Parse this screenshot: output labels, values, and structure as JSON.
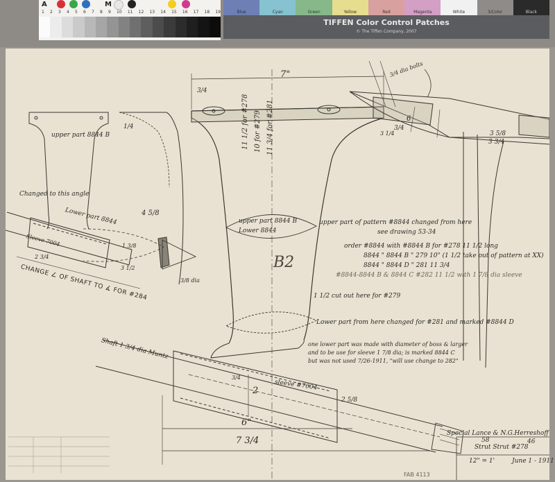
{
  "color_card": {
    "letters": [
      "A",
      "M",
      "B"
    ],
    "numbers": [
      "1",
      "2",
      "3",
      "4",
      "5",
      "6",
      "7",
      "8",
      "9",
      "10",
      "11",
      "12",
      "13",
      "14",
      "15",
      "16",
      "17",
      "18",
      "19"
    ],
    "swatch_colors": [
      "#d8313a",
      "#3aa64a",
      "#2f6fc0",
      "#e7e7e7",
      "#f4cd1e",
      "#d03a8e",
      "#222222"
    ]
  },
  "tiffen": {
    "patches": [
      "Blue",
      "Cyan",
      "Green",
      "Yellow",
      "Red",
      "Magenta",
      "White",
      "3/Color",
      "Black"
    ],
    "title": "TIFFEN Color Control Patches",
    "subtitle": "© The Tiffen Company, 2007"
  },
  "drawing": {
    "top_width": "7\"",
    "left_dim": "3/4",
    "dim_3_4_b": "3/4",
    "dim_1_4": "1/4",
    "upper_part_left": "upper part 8844 B",
    "change_angle": "Changed to this angle",
    "lower_part_left": "Lower part 8844",
    "sleeve_left": "Sleeve 7004",
    "dim_4_5_8": "4 5/8",
    "dim_2_3_4": "2 3/4",
    "dim_3_1_2": "3 1/2",
    "dim_1_3_8": "1 3/8",
    "dia_label": "3/8 dia",
    "change_shaft": "CHANGE ∠ OF SHAFT TO ∡ FOR #284",
    "stacked_1": "11 1/2 for #278",
    "stacked_2": "10 for #279",
    "stacked_3": "11 3/4 for #281",
    "upper_part_center": "upper part 8844 B",
    "lower_center": "Lower 8844",
    "upper_note_1": "upper part of pattern #8844 changed from here",
    "upper_note_2": "see drawing 53-34",
    "order_header": "order #8844 with #8844 B for #278  11 1/2 long",
    "order_row_2": "8844  \"  8844 B  \"  279  10\"  (1 1/2 take out of pattern at XX)",
    "order_row_3": "8844  \"  8844 D  \"  281  11 3/4",
    "order_row_4": "#8844-8844 B & 8844 C  #282  11 1/2 with 1 7/8 dia sleeve",
    "b_mark": "B2",
    "cut_out": "1 1/2 cut out here for #279",
    "lower_changed": "Lower part from here changed for #281 and marked #8844 D",
    "note_line_1": "one lower part was made with diameter of boss & larger",
    "note_line_2": "and to be use for sleeve 1 7/8 dia; is marked 8844 C",
    "note_line_3": "but was not used 7/26-1911, \"will use change to 282\"",
    "shaft_label": "Shaft 1 3/4 dia Muntz",
    "sleeve_center": "sleeve #7004",
    "dim_3_4_v": "3/4",
    "dim_2": "2",
    "dim_2_5_8": "2 5/8",
    "dim_6": "6\"",
    "dim_7_3_4": "7 3/4",
    "dim_3_5_8": "3 5/8",
    "dim_3_3_4": "3 3/4",
    "dim_6_right": "6",
    "dim_3_1_4": "3 1/4",
    "strut_dia": "3/4 dia bolts",
    "title_block_1": "Special Lance & N.G.Herreshoff",
    "title_block_no": "58",
    "title_block_no2": "46",
    "title_block_2": "Strut Strut #278",
    "scale": "12\" = 1'",
    "date": "June 1 - 1911",
    "stamp": "FAB 4113"
  }
}
